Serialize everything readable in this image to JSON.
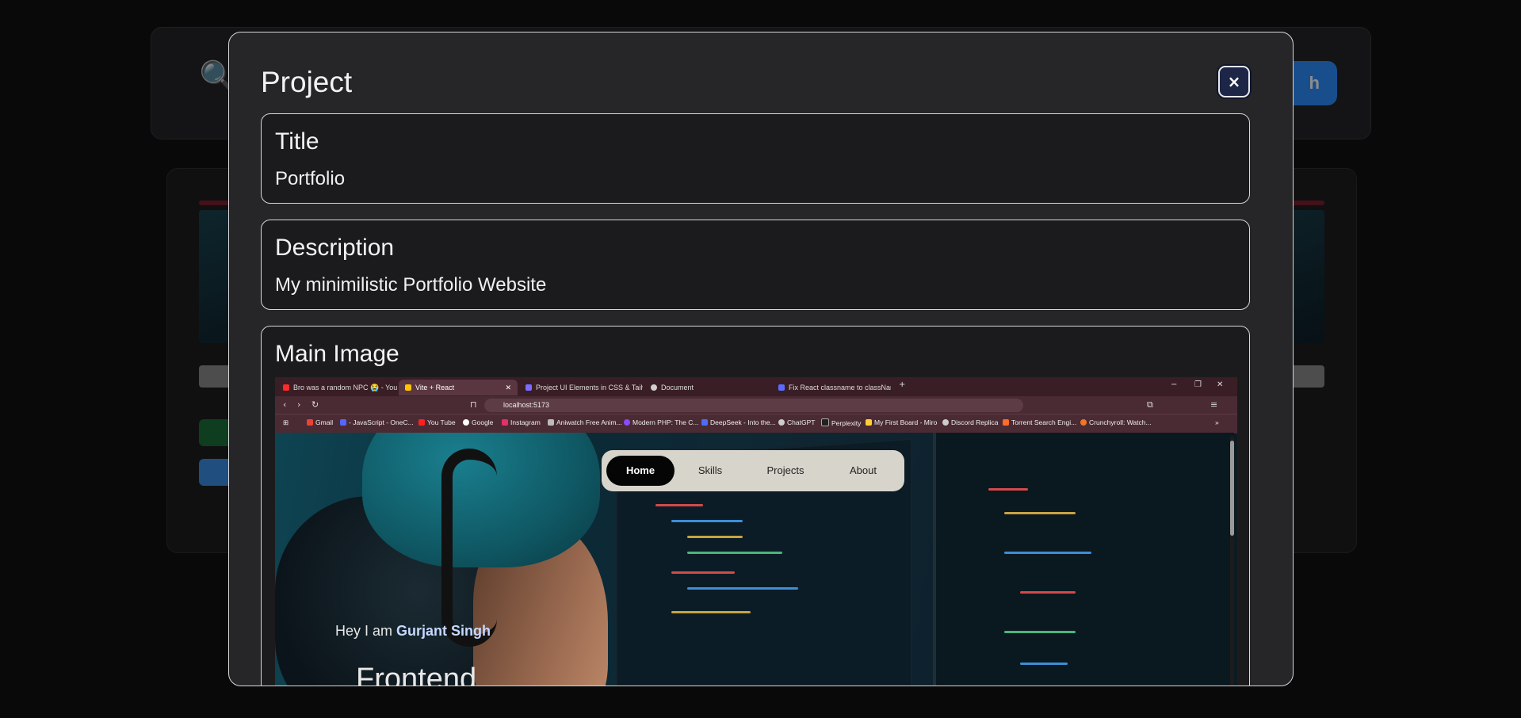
{
  "modal": {
    "title": "Project",
    "close_icon": "×",
    "fields": {
      "title_label": "Title",
      "title_value": "Portfolio",
      "description_label": "Description",
      "description_value": "My minimilistic Portfolio Website",
      "image_label": "Main Image"
    }
  },
  "screenshot": {
    "tabs": [
      {
        "label": "Bro was a random NPC 😭 - You",
        "icon_color": "#ff2b2b"
      },
      {
        "label": "Vite + React",
        "icon_color": "#ffc400",
        "active": true
      },
      {
        "label": "Project UI Elements in CSS & Tailwind",
        "icon_color": "#7a6cff"
      },
      {
        "label": "Document",
        "icon_color": "#cfcfcf"
      },
      {
        "label": "Fix React classname to className Err",
        "icon_color": "#5a6bff"
      }
    ],
    "url": "localhost:5173",
    "bookmarks": [
      "Gmail",
      "- JavaScript - OneC...",
      "You Tube",
      "Google",
      "Instagram",
      "Aniwatch Free Anim...",
      "Modern PHP: The C...",
      "DeepSeek - Into the...",
      "ChatGPT",
      "Perplexity",
      "My First Board - Miro",
      "Discord Replica",
      "Torrent Search Engi...",
      "Crunchyroll: Watch..."
    ],
    "nav": [
      "Home",
      "Skills",
      "Projects",
      "About"
    ],
    "hero_prefix": "Hey I am ",
    "hero_name": "Gurjant Singh",
    "hero_title": "Frontend"
  },
  "background": {
    "search_button_label": "h"
  },
  "colors": {
    "modal_bg": "#262628",
    "close_btn_bg": "#1d2647",
    "pill_nav_bg": "#d7d4cc",
    "accent_blue": "#2f8fff"
  }
}
